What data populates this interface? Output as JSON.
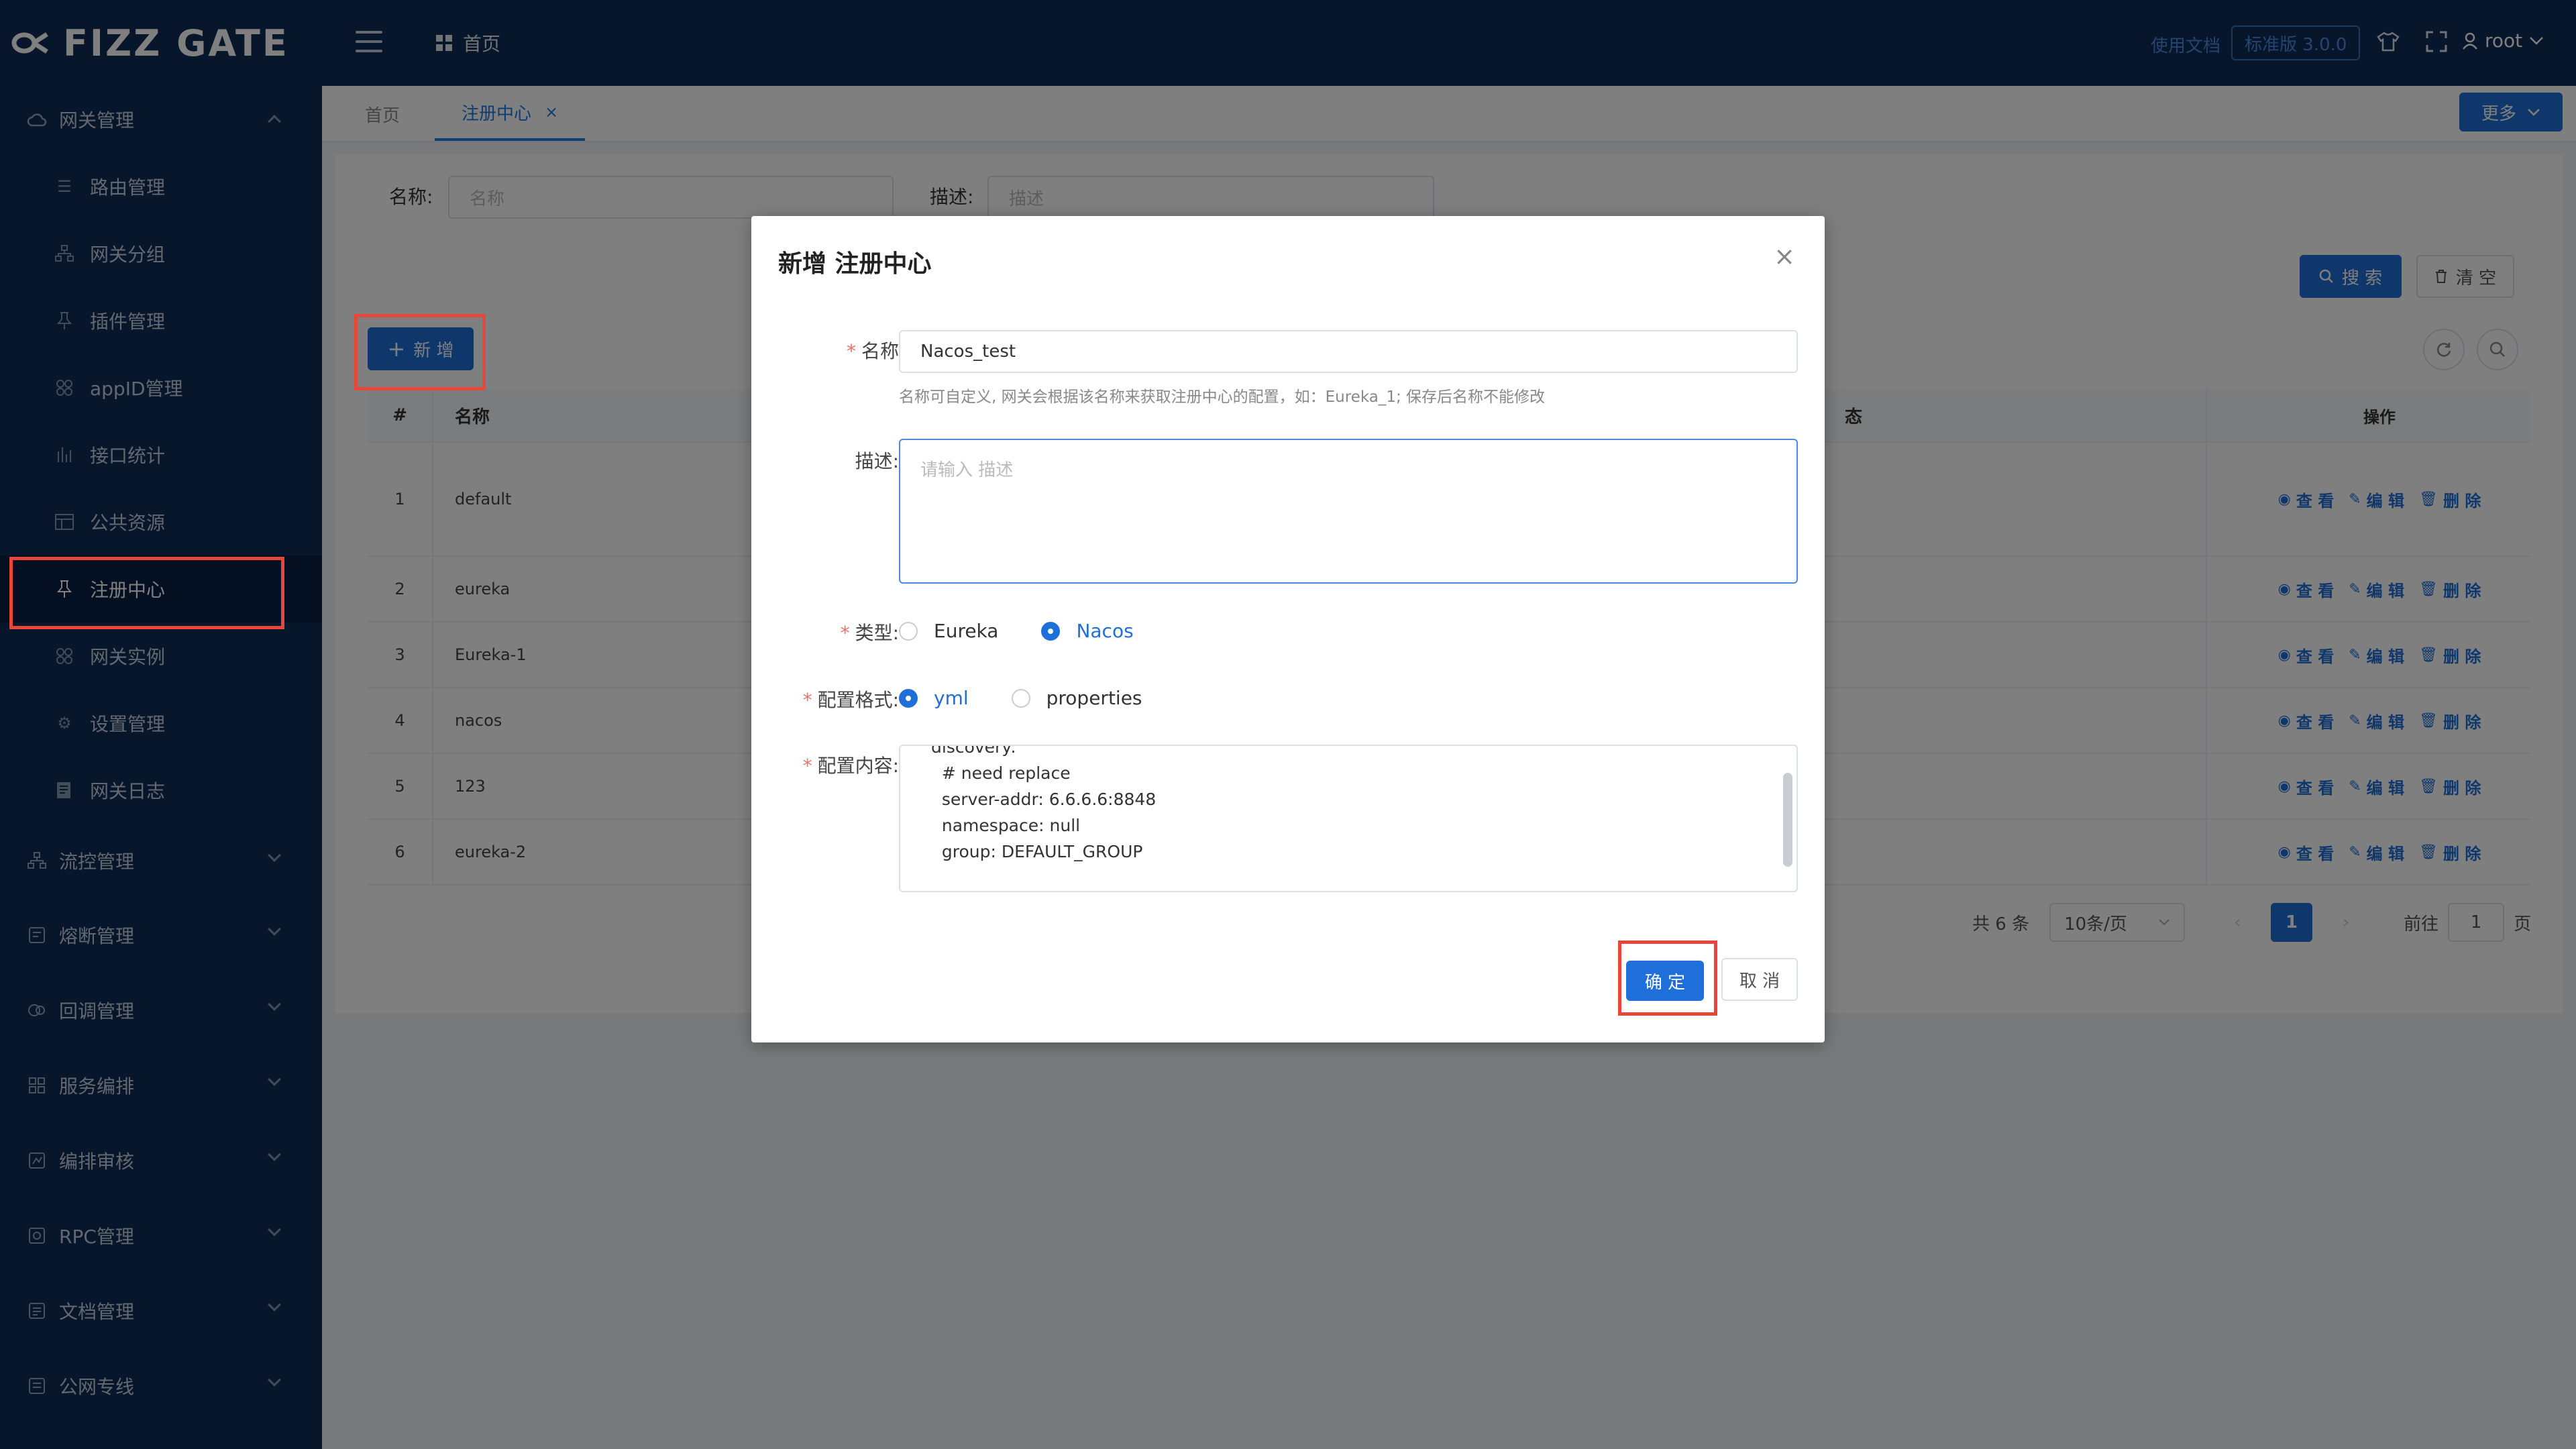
{
  "app": {
    "logo": "FIZZ GATE"
  },
  "header": {
    "home_label": "首页",
    "docs_label": "使用文档",
    "version_label": "标准版 3.0.0",
    "user_label": "root"
  },
  "sidebar": {
    "groups": [
      {
        "label": "网关管理",
        "expanded": true
      },
      {
        "label": "流控管理"
      },
      {
        "label": "熔断管理"
      },
      {
        "label": "回调管理"
      },
      {
        "label": "服务编排"
      },
      {
        "label": "编排审核"
      },
      {
        "label": "RPC管理"
      },
      {
        "label": "文档管理"
      },
      {
        "label": "公网专线"
      }
    ],
    "items": [
      {
        "label": "路由管理",
        "icon": "list-icon"
      },
      {
        "label": "网关分组",
        "icon": "hierarchy-icon"
      },
      {
        "label": "插件管理",
        "icon": "pin-icon"
      },
      {
        "label": "appID管理",
        "icon": "apps-icon"
      },
      {
        "label": "接口统计",
        "icon": "stats-icon"
      },
      {
        "label": "公共资源",
        "icon": "resource-icon"
      },
      {
        "label": "注册中心",
        "icon": "pin-icon",
        "active": true
      },
      {
        "label": "网关实例",
        "icon": "apps-icon"
      },
      {
        "label": "设置管理",
        "icon": "gear-icon"
      },
      {
        "label": "网关日志",
        "icon": "log-icon"
      }
    ]
  },
  "tabs": [
    {
      "label": "首页"
    },
    {
      "label": "注册中心",
      "active": true,
      "close": "×"
    }
  ],
  "more_label": "更多",
  "filters": {
    "name_label": "名称:",
    "name_placeholder": "名称",
    "desc_label": "描述:",
    "desc_placeholder": "描述",
    "search_label": "搜 索",
    "clear_label": "清 空",
    "add_label": "新 增"
  },
  "table": {
    "headers": {
      "index": "#",
      "name": "名称",
      "status_fragment": "态",
      "ops": "操作"
    },
    "ops": {
      "view": "查 看",
      "edit": "编 辑",
      "delete": "删 除"
    },
    "rows": [
      {
        "index": "1",
        "name": "default"
      },
      {
        "index": "2",
        "name": "eureka"
      },
      {
        "index": "3",
        "name": "Eureka-1"
      },
      {
        "index": "4",
        "name": "nacos"
      },
      {
        "index": "5",
        "name": "123"
      },
      {
        "index": "6",
        "name": "eureka-2"
      }
    ]
  },
  "pagination": {
    "total": "共 6 条",
    "page_size": "10条/页",
    "current": "1",
    "goto_label": "前往",
    "goto_value": "1",
    "page_suffix": "页"
  },
  "dialog": {
    "title": "新增 注册中心",
    "close": "×",
    "name_label": "名称",
    "name_value": "Nacos_test",
    "name_hint": "名称可自定义, 网关会根据该名称来获取注册中心的配置，如：Eureka_1; 保存后名称不能修改",
    "desc_label": "描述:",
    "desc_placeholder": "请输入 描述",
    "type_label": "类型:",
    "type_options": [
      "Eureka",
      "Nacos"
    ],
    "type_selected": "Nacos",
    "format_label": "配置格式:",
    "format_options": [
      "yml",
      "properties"
    ],
    "format_selected": "yml",
    "content_label": "配置内容:",
    "content_lines": [
      "discovery:",
      "  # need replace",
      "  server-addr: 6.6.6.6:8848",
      "  namespace: null",
      "  group: DEFAULT_GROUP"
    ],
    "ok_label": "确 定",
    "cancel_label": "取 消"
  },
  "colors": {
    "sidebar_bg": "#0f2c55",
    "primary": "#1e6fd9",
    "highlight": "#e8463a"
  }
}
